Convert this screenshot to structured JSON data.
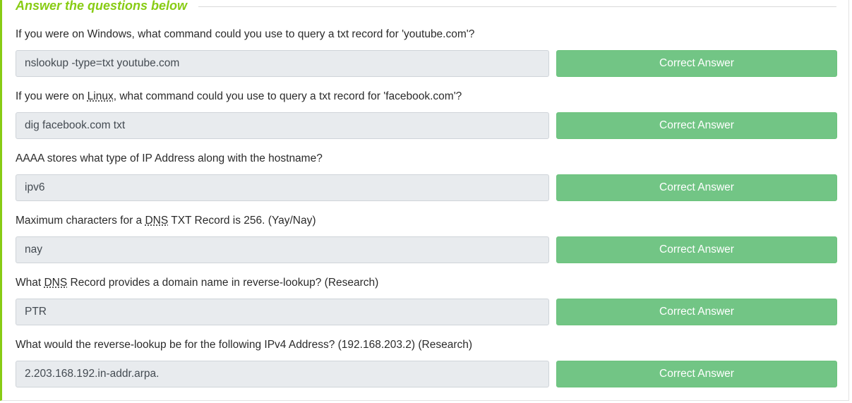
{
  "section": {
    "title": "Answer the questions below"
  },
  "colors": {
    "accent": "#88cc14",
    "correct_button": "#72c585"
  },
  "questions": [
    {
      "parts": [
        "If you were on Windows, what command could you use to query a txt record for 'youtube.com'?"
      ],
      "answer": "nslookup -type=txt youtube.com",
      "button_label": "Correct Answer"
    },
    {
      "parts": [
        "If you were on ",
        "Linux",
        ", what command could you use to query a txt record for 'facebook.com'?"
      ],
      "answer": "dig facebook.com txt",
      "button_label": "Correct Answer"
    },
    {
      "parts": [
        "AAAA stores what type of IP Address along with the hostname?"
      ],
      "answer": "ipv6",
      "button_label": "Correct Answer"
    },
    {
      "parts": [
        "Maximum characters for a ",
        "DNS",
        " TXT Record is 256. (Yay/Nay)"
      ],
      "answer": "nay",
      "button_label": "Correct Answer"
    },
    {
      "parts": [
        "What ",
        "DNS",
        " Record provides a domain name in reverse-lookup? (Research)"
      ],
      "answer": "PTR",
      "button_label": "Correct Answer"
    },
    {
      "parts": [
        "What would the reverse-lookup be for the following IPv4 Address? (192.168.203.2) (Research)"
      ],
      "answer": "2.203.168.192.in-addr.arpa.",
      "button_label": "Correct Answer"
    }
  ]
}
